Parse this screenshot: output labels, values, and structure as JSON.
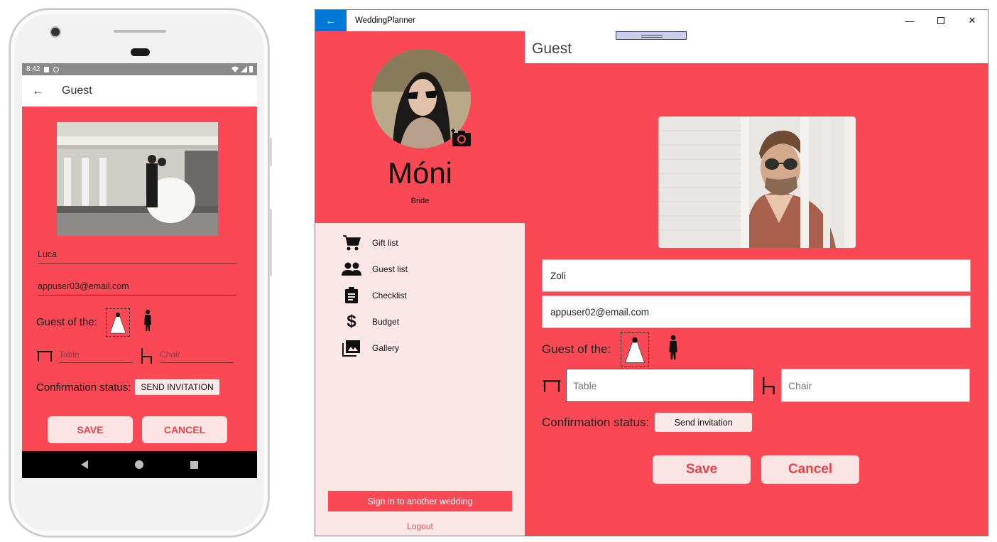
{
  "mobile": {
    "status_time": "8:42",
    "header_title": "Guest",
    "name_value": "Luca",
    "email_value": "appuser03@email.com",
    "guest_of_label": "Guest of the:",
    "table_placeholder": "Table",
    "chair_placeholder": "Chair",
    "confirmation_label": "Confirmation status:",
    "send_invitation_label": "SEND INVITATION",
    "save_label": "SAVE",
    "cancel_label": "CANCEL"
  },
  "desktop": {
    "window_title": "WeddingPlanner",
    "profile": {
      "name": "Móni",
      "role": "Bride"
    },
    "sidebar": {
      "items": [
        {
          "label": "Gift list",
          "icon": "cart-icon"
        },
        {
          "label": "Guest list",
          "icon": "people-icon"
        },
        {
          "label": "Checklist",
          "icon": "clipboard-icon"
        },
        {
          "label": "Budget",
          "icon": "dollar-icon"
        },
        {
          "label": "Gallery",
          "icon": "gallery-icon"
        }
      ],
      "signin_label": "Sign in to another wedding",
      "logout_label": "Logout"
    },
    "page_title": "Guest",
    "name_value": "Zoli",
    "email_value": "appuser02@email.com",
    "guest_of_label": "Guest of the:",
    "table_placeholder": "Table",
    "chair_placeholder": "Chair",
    "confirmation_label": "Confirmation status:",
    "send_invitation_label": "Send invitation",
    "save_label": "Save",
    "cancel_label": "Cancel"
  },
  "colors": {
    "accent": "#fb4855",
    "panel_light": "#fbe7e6",
    "button_bg": "#fbe4e3",
    "button_text": "#e8434d",
    "titlebar_accent": "#0078d7"
  }
}
